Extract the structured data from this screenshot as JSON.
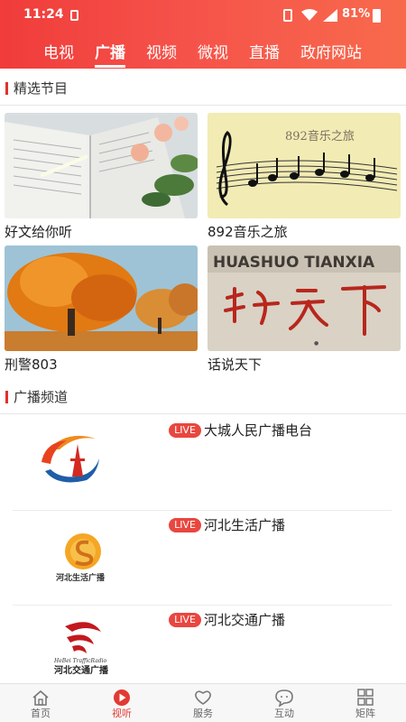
{
  "status_bar": {
    "time": "11:24",
    "battery": "81%"
  },
  "tabs": [
    {
      "label": "电视"
    },
    {
      "label": "广播",
      "active": true
    },
    {
      "label": "视频"
    },
    {
      "label": "微视"
    },
    {
      "label": "直播"
    },
    {
      "label": "政府网站"
    }
  ],
  "featured": {
    "title": "精选节目",
    "items": [
      {
        "label": "好文给你听"
      },
      {
        "label": "892音乐之旅",
        "image_text": "892音乐之旅"
      },
      {
        "label": "刑警803"
      },
      {
        "label": "话说天下",
        "image_text": "HUASHUO TIANXIA"
      }
    ]
  },
  "channels": {
    "title": "广播频道",
    "live_label": "LIVE",
    "items": [
      {
        "name": "大城人民广播电台"
      },
      {
        "name": "河北生活广播",
        "logo_text": "河北生活广播"
      },
      {
        "name": "河北交通广播",
        "logo_text": "河北交通广播",
        "logo_sub": "HeBei TrafficRadio"
      }
    ]
  },
  "bottom_nav": [
    {
      "label": "首页",
      "icon": "home-icon"
    },
    {
      "label": "视听",
      "icon": "play-icon",
      "active": true
    },
    {
      "label": "服务",
      "icon": "heart-icon"
    },
    {
      "label": "互动",
      "icon": "chat-icon"
    },
    {
      "label": "矩阵",
      "icon": "grid-icon"
    }
  ],
  "colors": {
    "accent": "#e23a33",
    "header_start": "#f03c3a",
    "header_end": "#f86a4c"
  }
}
